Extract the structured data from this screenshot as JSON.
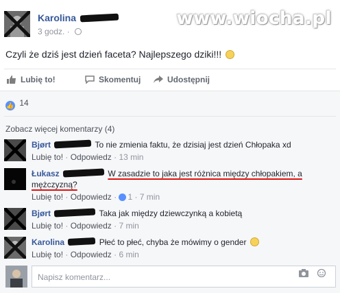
{
  "post": {
    "author": "Karolina",
    "time": "3 godz.",
    "text": "Czyli że dziś jest dzień faceta? Najlepszego dziki!!!",
    "watermark": "www.wiocha.pl"
  },
  "actions": {
    "like": "Lubię to!",
    "comment": "Skomentuj",
    "share": "Udostępnij"
  },
  "likes": {
    "count": "14"
  },
  "more_comments": "Zobacz więcej komentarzy (4)",
  "comments": [
    {
      "name": "Bjørt",
      "text": "To nie zmienia faktu, że dzisiaj jest dzień Chłopaka xd",
      "like": "Lubię to!",
      "reply": "Odpowiedz",
      "time": "13 min"
    },
    {
      "name": "Łukasz",
      "text": "W zasadzie to jaka jest różnica między chłopakiem, a mężczyzną?",
      "like": "Lubię to!",
      "reply": "Odpowiedz",
      "likes": "1",
      "time": "7 min"
    },
    {
      "name": "Bjørt",
      "text": "Taka jak między dziewczynką a kobietą",
      "like": "Lubię to!",
      "reply": "Odpowiedz",
      "time": "7 min"
    },
    {
      "name": "Karolina",
      "text": "Płeć to płeć, chyba że mówimy o gender",
      "like": "Lubię to!",
      "reply": "Odpowiedz",
      "time": "6 min"
    }
  ],
  "composer": {
    "placeholder": "Napisz komentarz..."
  },
  "colors": {
    "link": "#365899",
    "accent": "#5890ff",
    "highlight": "#e01010"
  }
}
